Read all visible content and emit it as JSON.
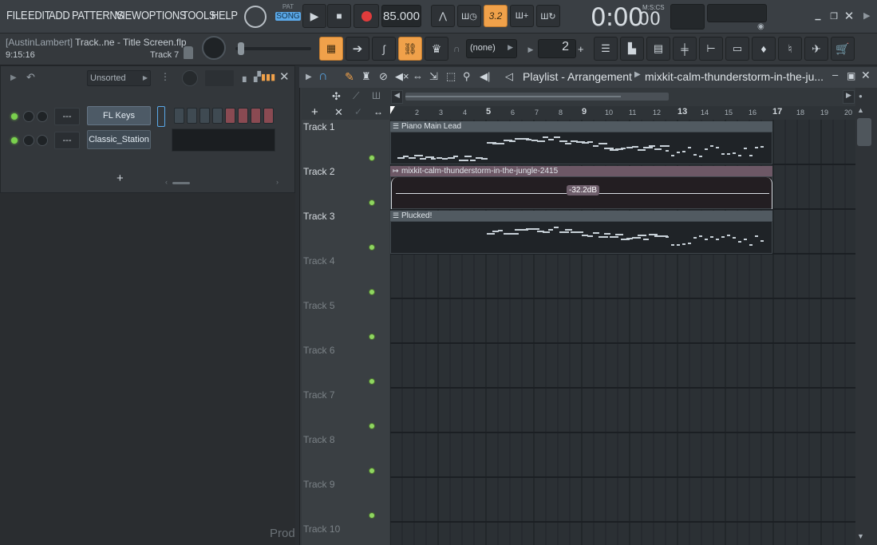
{
  "menu": [
    "FILE",
    "EDIT",
    "ADD",
    "PATTERNS",
    "VIEW",
    "OPTIONS",
    "TOOLS",
    "HELP"
  ],
  "transport": {
    "pat_label": "PAT",
    "song_label": "SONG",
    "tempo": "85.000",
    "time": "0:00",
    "time_cs": "00",
    "time_format": "M:S:CS",
    "pattern_num": "3.2"
  },
  "project": {
    "user": "[AustinLambert]",
    "file": "Track..ne - Title Screen.flp",
    "clock": "9:15:16",
    "hint_track": "Track 7"
  },
  "toolbar": {
    "pattern_select": "(none)",
    "snap_value": "2"
  },
  "rack": {
    "filter": "Unsorted",
    "add_label": "+",
    "channels": [
      {
        "name": "FL Keys",
        "mute": "---"
      },
      {
        "name": "Classic_Station",
        "mute": "---"
      }
    ]
  },
  "playlist": {
    "title": "Playlist - Arrangement",
    "breadcrumb": "mixkit-calm-thunderstorm-in-the-ju...",
    "ruler": [
      "2",
      "3",
      "4",
      "5",
      "6",
      "7",
      "8",
      "9",
      "10",
      "11",
      "12",
      "13",
      "14",
      "15",
      "16",
      "17",
      "18",
      "19",
      "20"
    ],
    "tracks": [
      "Track 1",
      "Track 2",
      "Track 3",
      "Track 4",
      "Track 5",
      "Track 6",
      "Track 7",
      "Track 8",
      "Track 9",
      "Track 10"
    ],
    "clips": [
      {
        "name": "Piano Main Lead"
      },
      {
        "name": "mixkit-calm-thunderstorm-in-the-jungle-2415",
        "gain": "-32.2dB"
      },
      {
        "name": "Plucked!"
      }
    ]
  },
  "bottom_hint": "Prod",
  "colors": {
    "accent": "#f0a14a",
    "led": "#7ad14d"
  },
  "icons": [
    "cpu-icon",
    "play-icon",
    "stop-icon",
    "record-icon",
    "metronome-icon",
    "wave-icon",
    "channel-rack-icon",
    "mixer-icon",
    "plugin-icon",
    "browser-icon",
    "shop-icon"
  ]
}
